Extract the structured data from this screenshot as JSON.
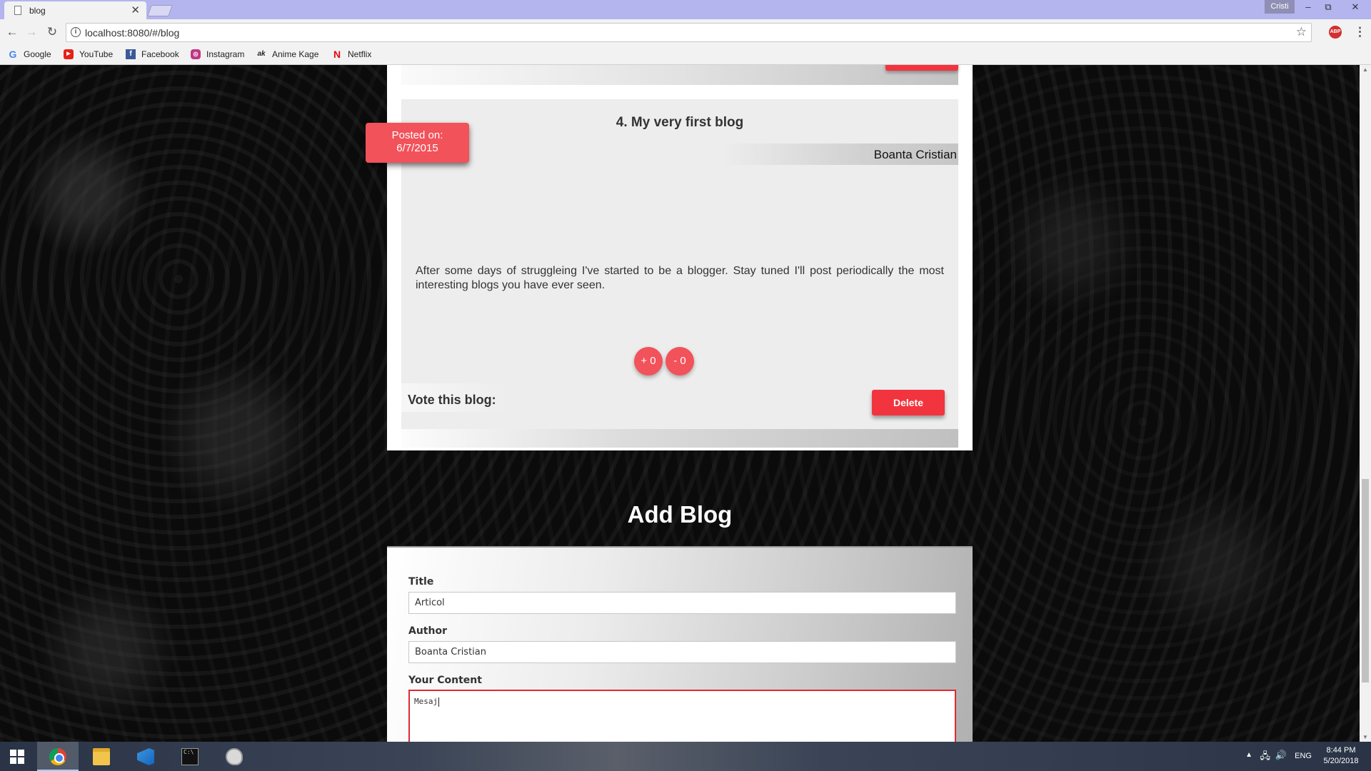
{
  "browser": {
    "tab_title": "blog",
    "tab_close": "✕",
    "profile_name": "Cristi",
    "url": "localhost:8080/#/blog",
    "bookmarks": [
      {
        "label": "Google",
        "icon": "G"
      },
      {
        "label": "YouTube",
        "icon": "▶"
      },
      {
        "label": "Facebook",
        "icon": "f"
      },
      {
        "label": "Instagram",
        "icon": "◎"
      },
      {
        "label": "Anime Kage",
        "icon": "ak"
      },
      {
        "label": "Netflix",
        "icon": "N"
      }
    ],
    "abp_label": "ABP"
  },
  "post": {
    "title": "4. My very first blog",
    "author": "Boanta Cristian",
    "posted_label": "Posted on:",
    "posted_date": "6/7/2015",
    "body": "After some days of struggleing I've started to be a blogger. Stay tuned I'll post periodically the most interesting blogs you have ever seen.",
    "vote_label": "Vote this blog:",
    "vote_up": "+ 0",
    "vote_down": "- 0",
    "delete_label": "Delete"
  },
  "add_blog": {
    "heading": "Add Blog",
    "title_label": "Title",
    "title_value": "Articol",
    "author_label": "Author",
    "author_value": "Boanta Cristian",
    "content_label": "Your Content",
    "content_value": "Mesaj"
  },
  "taskbar": {
    "language": "ENG",
    "time": "8:44 PM",
    "date": "5/20/2018"
  },
  "colors": {
    "accent_red": "#f2525a",
    "delete_red": "#f2343e",
    "tab_bar": "#b4b4ee"
  }
}
